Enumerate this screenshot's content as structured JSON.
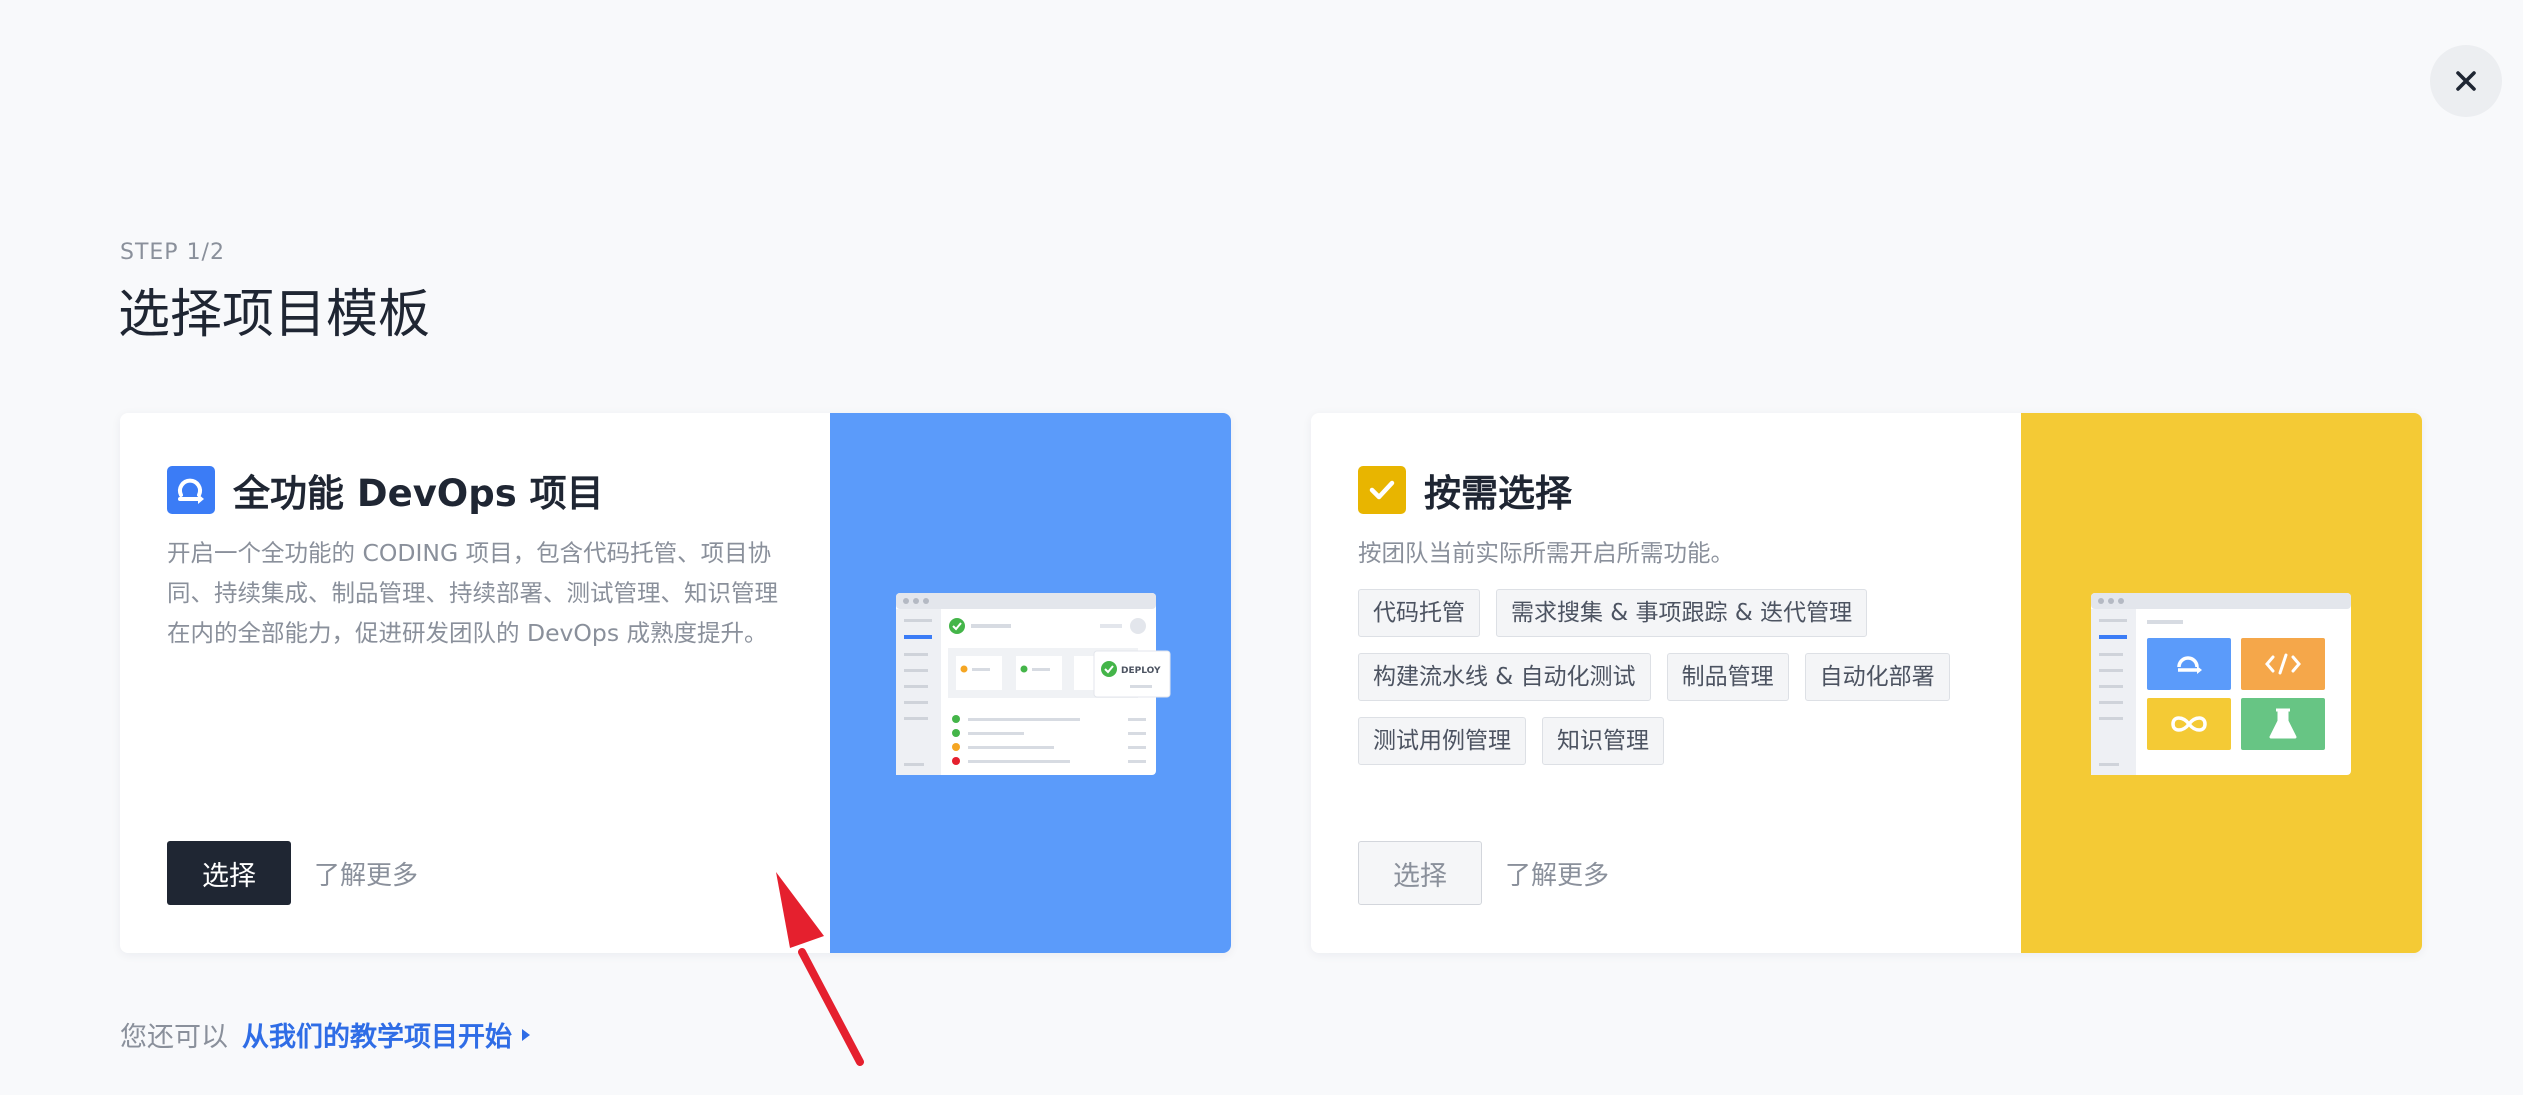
{
  "header": {
    "close_icon": "close-icon",
    "step": "STEP 1/2",
    "title": "选择项目模板"
  },
  "cards": [
    {
      "title": "全功能 DevOps 项目",
      "icon": "devops-loop-icon",
      "icon_color": "#3b7cf6",
      "description": "开启一个全功能的 CODING 项目，包含代码托管、项目协同、持续集成、制品管理、持续部署、测试管理、知识管理在内的全部能力，促进研发团队的 DevOps 成熟度提升。",
      "select_label": "选择",
      "learn_more": "了解更多",
      "art_color": "#5b9bfa",
      "illustration": {
        "deploy_label": "DEPLOY"
      }
    },
    {
      "title": "按需选择",
      "icon": "checkbox-icon",
      "icon_color": "#e8b500",
      "description": "按团队当前实际所需开启所需功能。",
      "tags": [
        "代码托管",
        "需求搜集 & 事项跟踪 & 迭代管理",
        "构建流水线 & 自动化测试",
        "制品管理",
        "自动化部署",
        "测试用例管理",
        "知识管理"
      ],
      "select_label": "选择",
      "learn_more": "了解更多",
      "art_color": "#f4ca35"
    }
  ],
  "footer": {
    "prefix": "您还可以",
    "link": "从我们的教学项目开始"
  },
  "colors": {
    "primary_dark": "#1f2633",
    "link_blue": "#2f6de6",
    "annotation_red": "#e5202e"
  }
}
